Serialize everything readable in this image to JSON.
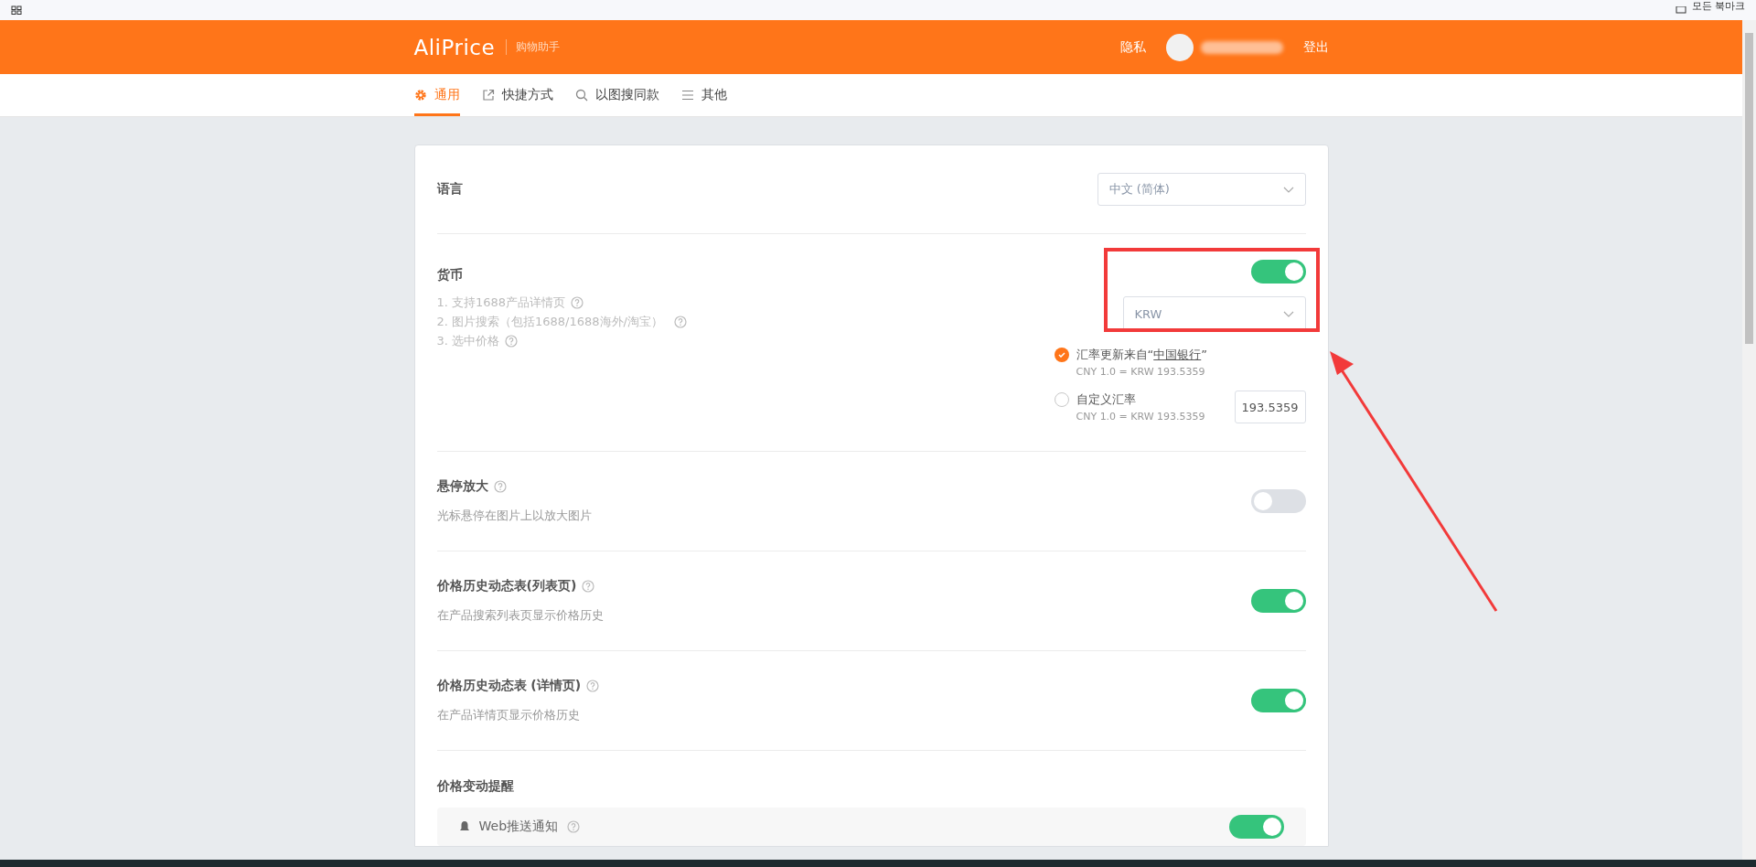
{
  "browser_bar": {
    "bookmarks_label": "모든 북마크"
  },
  "header": {
    "logo": "AliPrice",
    "tagline": "购物助手",
    "privacy_link": "隐私",
    "logout_link": "登出"
  },
  "tabs": [
    {
      "label": "通用",
      "selected": true
    },
    {
      "label": "快捷方式",
      "selected": false
    },
    {
      "label": "以图搜同款",
      "selected": false
    },
    {
      "label": "其他",
      "selected": false
    }
  ],
  "language": {
    "label": "语言",
    "value": "中文 (简体)"
  },
  "currency": {
    "label": "货币",
    "notes": [
      "1. 支持1688产品详情页",
      "2. 图片搜索（包括1688/1688海外/淘宝）",
      "3. 选中价格"
    ],
    "on": true,
    "value": "KRW",
    "options": [
      {
        "label": "汇率更新来自“**中国银行**”",
        "rate": "CNY 1.0 = KRW 193.5359",
        "selected": true
      },
      {
        "label": "自定义汇率",
        "rate": "CNY 1.0 = KRW 193.5359",
        "selected": false,
        "value": "193.5359"
      }
    ]
  },
  "toggles": [
    {
      "title": "悬停放大",
      "description": "光标悬停在图片上以放大图片",
      "on": false
    },
    {
      "title": "价格历史动态表(列表页)",
      "description": "在产品搜索列表页显示价格历史",
      "on": true
    },
    {
      "title": "价格历史动态表 (详情页)",
      "description": "在产品详情页显示价格历史",
      "on": true
    }
  ],
  "price_alert": {
    "title": "价格变动提醒",
    "items": [
      {
        "label": "Web推送通知",
        "on": true
      }
    ]
  }
}
